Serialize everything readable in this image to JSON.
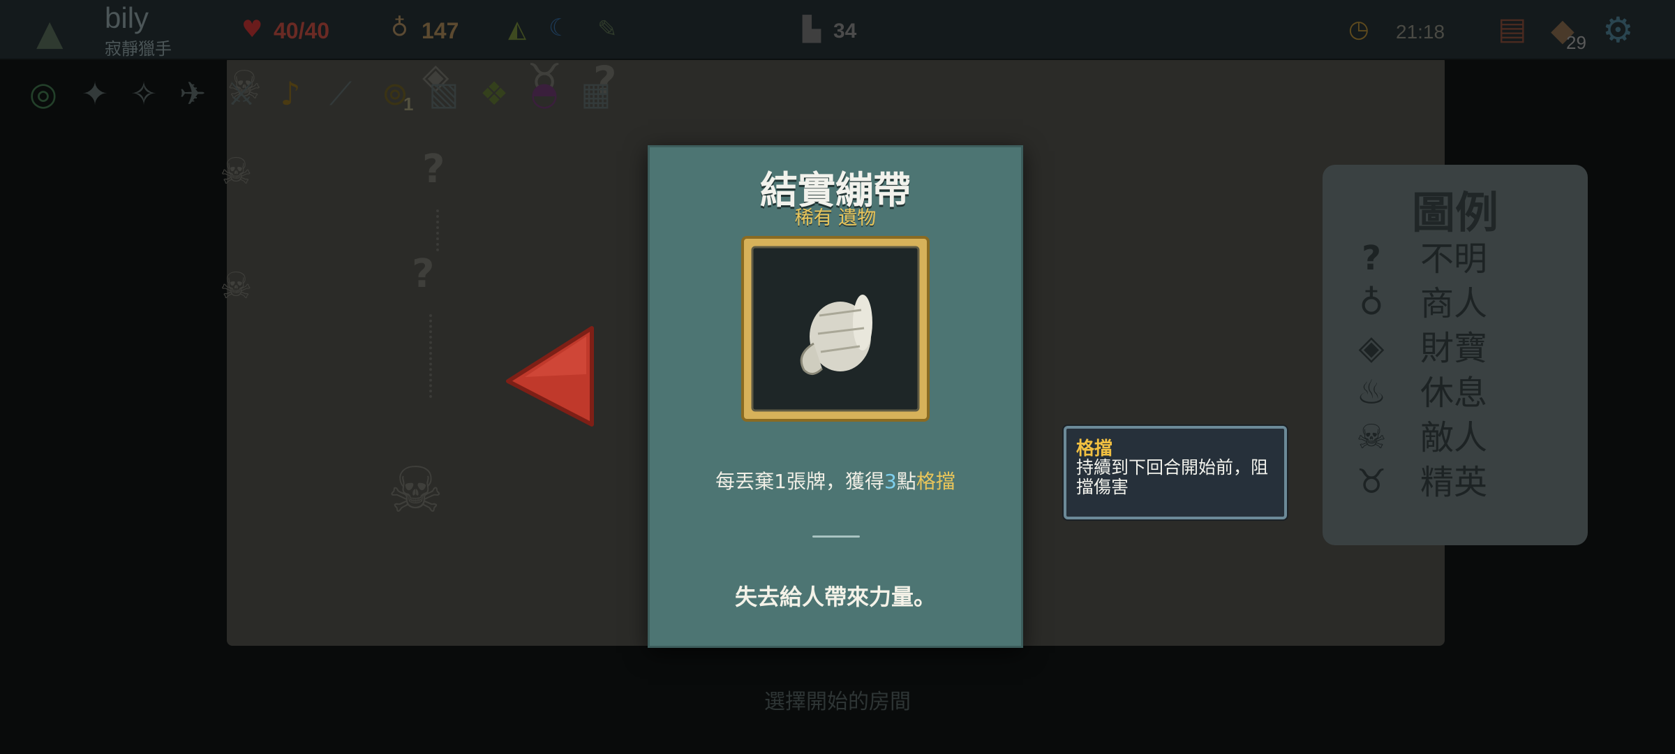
{
  "player": {
    "name": "bily",
    "title": "寂靜獵手",
    "hp": "40/40",
    "gold": "147",
    "deck_count": "34",
    "timer": "21:18",
    "draw_count": "29",
    "potion_count": "1"
  },
  "icons": {
    "character": "character-emblem-icon",
    "hp": "heart-icon",
    "gold": "gold-pouch-icon",
    "potion": "potion-icon",
    "map": "map-icon",
    "deck": "deck-icon",
    "timer": "clock-icon",
    "settings": "gear-icon"
  },
  "legend": {
    "title": "圖例",
    "items": [
      {
        "icon": "question-icon",
        "label": "不明"
      },
      {
        "icon": "merchant-icon",
        "label": "商人"
      },
      {
        "icon": "treasure-icon",
        "label": "財寶"
      },
      {
        "icon": "rest-icon",
        "label": "休息"
      },
      {
        "icon": "enemy-icon",
        "label": "敵人"
      },
      {
        "icon": "elite-icon",
        "label": "精英"
      }
    ]
  },
  "relic_card": {
    "name": "結實繃帶",
    "rarity": "稀有 遺物",
    "desc_before": "每丟棄1張牌，獲得",
    "desc_number": "3",
    "desc_middle": "點",
    "desc_keyword": "格擋",
    "flavor": "失去給人帶來力量。"
  },
  "tooltip": {
    "title": "格擋",
    "body": "持續到下回合開始前，阻擋傷害"
  },
  "bottom_hint": "選擇開始的房間",
  "colors": {
    "card_bg": "#4d7573",
    "gold_text": "#e9c55a",
    "number_blue": "#7fd0ef",
    "back_arrow": "#c0392b"
  }
}
